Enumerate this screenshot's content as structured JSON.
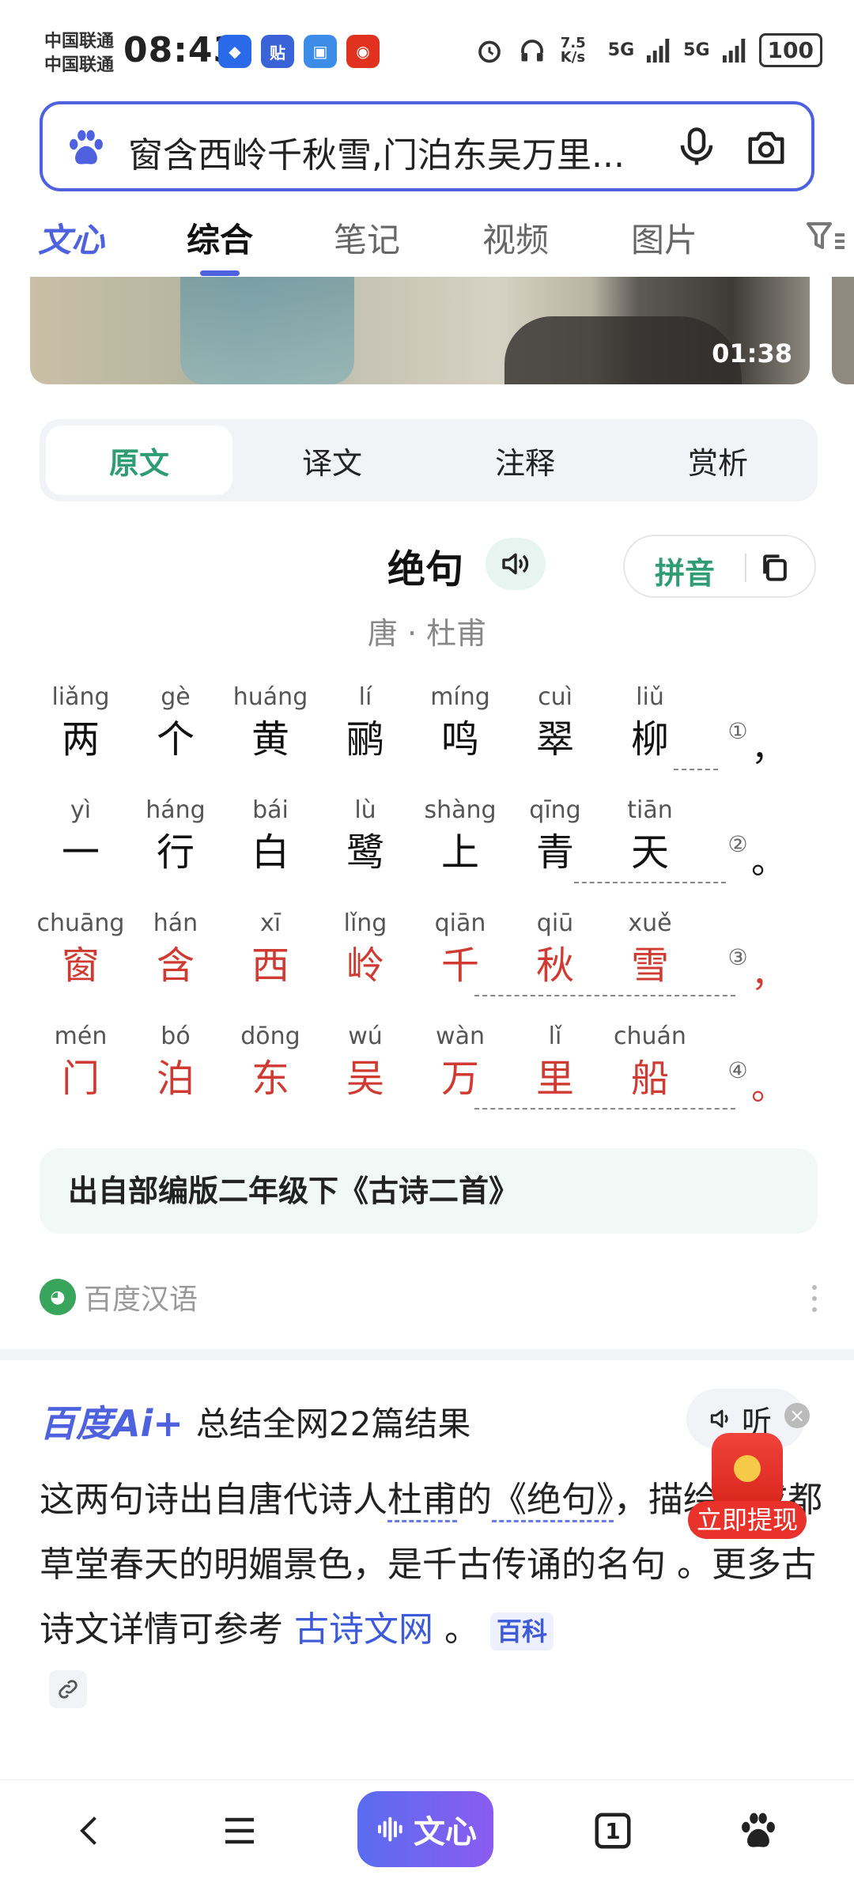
{
  "status_bar": {
    "carrier_1": "中国联通",
    "carrier_2": "中国联通",
    "time": "08:43",
    "network_speed": "7.5 K/s",
    "signal_1": "5G",
    "signal_2": "5G",
    "battery": "100"
  },
  "search": {
    "query": "窗含西岭千秋雪,门泊东吴万里..."
  },
  "tabs": [
    {
      "label": "文心"
    },
    {
      "label": "综合"
    },
    {
      "label": "笔记"
    },
    {
      "label": "视频"
    },
    {
      "label": "图片"
    }
  ],
  "video": {
    "duration": "01:38"
  },
  "segments": [
    "原文",
    "译文",
    "注释",
    "赏析"
  ],
  "poem": {
    "title": "绝句",
    "pinyin_button": "拼音",
    "author": "唐 · 杜甫",
    "lines": [
      {
        "chars": [
          "两",
          "个",
          "黄",
          "鹂",
          "鸣",
          "翠",
          "柳"
        ],
        "pinyin": [
          "liǎng",
          "gè",
          "huáng",
          "lí",
          "míng",
          "cuì",
          "liǔ"
        ],
        "note": "①",
        "punct": "，"
      },
      {
        "chars": [
          "一",
          "行",
          "白",
          "鹭",
          "上",
          "青",
          "天"
        ],
        "pinyin": [
          "yì",
          "háng",
          "bái",
          "lù",
          "shàng",
          "qīng",
          "tiān"
        ],
        "note": "②",
        "punct": "。"
      },
      {
        "chars": [
          "窗",
          "含",
          "西",
          "岭",
          "千",
          "秋",
          "雪"
        ],
        "pinyin": [
          "chuāng",
          "hán",
          "xī",
          "lǐng",
          "qiān",
          "qiū",
          "xuě"
        ],
        "note": "③",
        "punct": "，"
      },
      {
        "chars": [
          "门",
          "泊",
          "东",
          "吴",
          "万",
          "里",
          "船"
        ],
        "pinyin": [
          "mén",
          "bó",
          "dōng",
          "wú",
          "wàn",
          "lǐ",
          "chuán"
        ],
        "note": "④",
        "punct": "。"
      }
    ],
    "source": "出自部编版二年级下《古诗二首》"
  },
  "site": {
    "name": "百度汉语"
  },
  "ai": {
    "logo": "百度Ai+",
    "summary": "总结全网22篇结果",
    "listen": "听",
    "text_1": "这两句诗出自唐代诗人",
    "text_author": "杜甫",
    "text_2": "的",
    "text_work": "《绝句》",
    "text_3": "，描绘了成都草堂春天的明媚景色，是千古传诵的名句 。更多古诗文详情可参考 ",
    "link": "古诗文网",
    "text_4": " 。",
    "tag": "百科"
  },
  "promo": {
    "label": "立即提现"
  },
  "bottom_nav": {
    "wenxin": "文心",
    "tab_count": "1"
  }
}
